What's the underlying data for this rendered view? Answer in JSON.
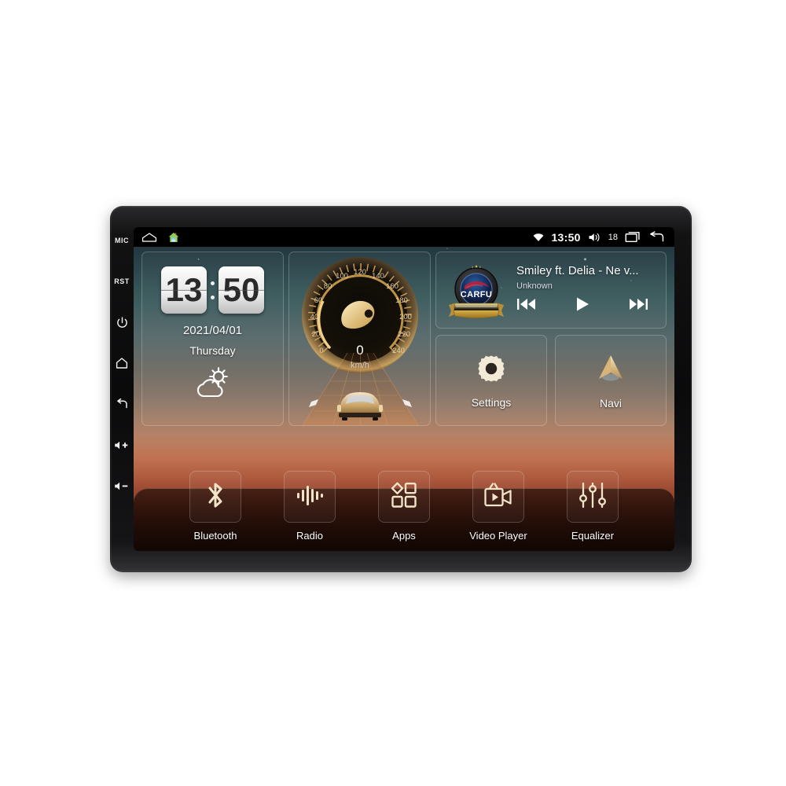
{
  "device": {
    "hardware_keys": [
      {
        "name": "mic",
        "label": "MIC",
        "icon": "text"
      },
      {
        "name": "reset",
        "label": "RST",
        "icon": "text"
      },
      {
        "name": "power",
        "label": "",
        "icon": "power-icon"
      },
      {
        "name": "home",
        "label": "",
        "icon": "home-icon"
      },
      {
        "name": "back",
        "label": "",
        "icon": "back-arrow-icon"
      },
      {
        "name": "volume-up",
        "label": "",
        "icon": "volume-up-icon"
      },
      {
        "name": "volume-down",
        "label": "",
        "icon": "volume-down-icon"
      }
    ]
  },
  "statusbar": {
    "left_icons": [
      "overview-icon",
      "home-house-icon"
    ],
    "wifi_icon": "wifi-icon",
    "time": "13:50",
    "volume_icon": "speaker-icon",
    "volume_level": "18",
    "recents_icon": "recents-icon",
    "back_icon": "back-arrow-icon"
  },
  "clock_widget": {
    "hours": "13",
    "minutes": "50",
    "date": "2021/04/01",
    "weekday": "Thursday",
    "weather_icon": "partly-cloudy-icon"
  },
  "speed_widget": {
    "value": "0",
    "unit": "km/h",
    "tick_labels": [
      "0",
      "20",
      "40",
      "60",
      "80",
      "100",
      "120",
      "140",
      "160",
      "180",
      "200",
      "220",
      "240"
    ],
    "min": 0,
    "max": 240,
    "needle_icon": "gauge-needle-icon",
    "car_icon": "car-icon"
  },
  "music_widget": {
    "album_art": "carfu-badge-logo",
    "album_art_text": "CARFU",
    "title": "Smiley ft. Delia - Ne v...",
    "artist": "Unknown",
    "controls": [
      {
        "name": "previous-track-button",
        "icon": "skip-previous-icon"
      },
      {
        "name": "play-button",
        "icon": "play-icon"
      },
      {
        "name": "next-track-button",
        "icon": "skip-next-icon"
      }
    ]
  },
  "tiles": [
    {
      "name": "settings",
      "label": "Settings",
      "icon": "gear-icon"
    },
    {
      "name": "navi",
      "label": "Navi",
      "icon": "navigation-arrow-icon"
    }
  ],
  "dock": [
    {
      "name": "bluetooth",
      "label": "Bluetooth",
      "icon": "bluetooth-icon"
    },
    {
      "name": "radio",
      "label": "Radio",
      "icon": "radio-waveform-icon"
    },
    {
      "name": "apps",
      "label": "Apps",
      "icon": "apps-grid-icon"
    },
    {
      "name": "video-player",
      "label": "Video Player",
      "icon": "video-camera-icon"
    },
    {
      "name": "equalizer",
      "label": "Equalizer",
      "icon": "equalizer-sliders-icon"
    }
  ],
  "colors": {
    "page_background": "#ffffff",
    "bezel": "#121213",
    "statusbar": "#000000",
    "sky_top": "#1d2a33",
    "sky_mid": "#3a5a5c",
    "sunset_orange": "#b86a4c",
    "ground_dark": "#2c120c",
    "gauge_gold": "#d8a858",
    "icon_cream": "#f0e2c8",
    "text_primary": "#ffffff"
  }
}
